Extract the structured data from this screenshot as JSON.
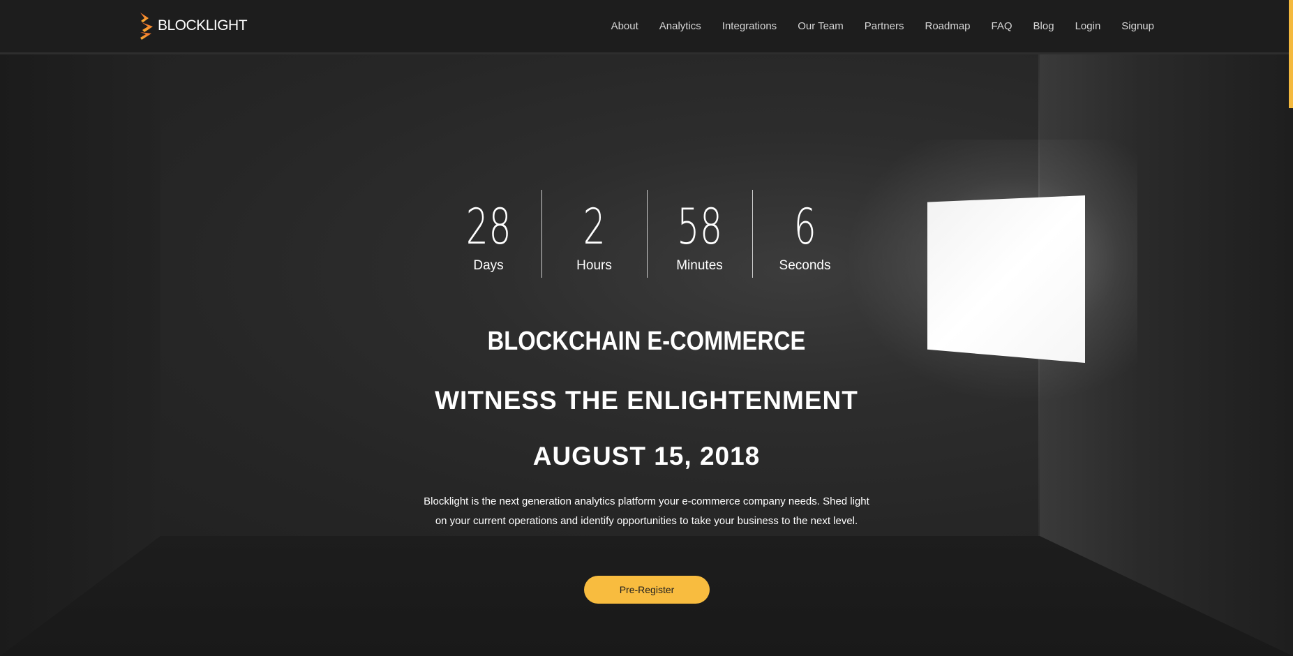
{
  "brand": {
    "logo_text": "BLOCKLIGHT",
    "accent_color": "#f8bc3f",
    "logo_icon": "blocklight-logo-icon"
  },
  "nav": {
    "items": [
      {
        "label": "About"
      },
      {
        "label": "Analytics"
      },
      {
        "label": "Integrations"
      },
      {
        "label": "Our Team"
      },
      {
        "label": "Partners"
      },
      {
        "label": "Roadmap"
      },
      {
        "label": "FAQ"
      },
      {
        "label": "Blog"
      },
      {
        "label": "Login"
      },
      {
        "label": "Signup"
      }
    ]
  },
  "countdown": {
    "units": [
      {
        "value": "28",
        "label": "Days"
      },
      {
        "value": "2",
        "label": "Hours"
      },
      {
        "value": "58",
        "label": "Minutes"
      },
      {
        "value": "6",
        "label": "Seconds"
      }
    ]
  },
  "hero": {
    "headline": "BLOCKCHAIN E-COMMERCE",
    "subheadline": "WITNESS THE ENLIGHTENMENT",
    "date": "AUGUST 15, 2018",
    "description": "Blocklight is the next generation analytics platform your e-commerce company needs. Shed light on your current operations and identify opportunities to take your business to the next level.",
    "cta_label": "Pre-Register"
  }
}
